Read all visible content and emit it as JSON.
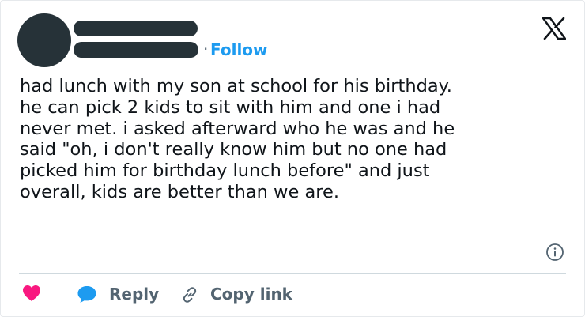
{
  "header": {
    "follow_label": "Follow",
    "separator": "·",
    "logo_icon": "x-logo-icon"
  },
  "tweet": {
    "lines": [
      "had lunch with my son at school for his birthday.",
      "he can pick 2 kids to sit with him and one i had",
      "never met. i asked afterward who he was and he",
      "said \"oh, i don't really know him but no one had",
      "picked him for birthday lunch before\" and just",
      "overall, kids are better than we are."
    ]
  },
  "actions": {
    "like_icon": "heart-icon",
    "reply_label": "Reply",
    "copy_link_label": "Copy link",
    "info_icon": "info-icon"
  },
  "colors": {
    "accent": "#1d9bf0",
    "heart": "#f91880",
    "redaction": "#263238",
    "muted_text": "#536471"
  }
}
